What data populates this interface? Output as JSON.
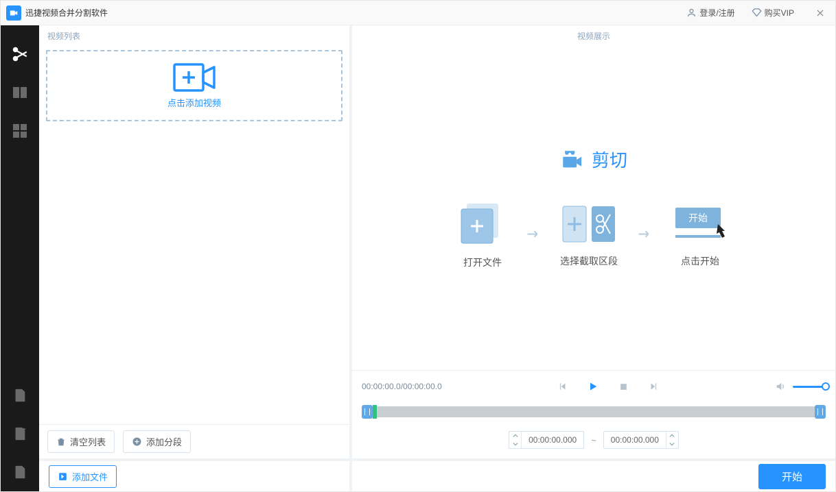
{
  "app": {
    "title": "迅捷视频合并分割软件"
  },
  "titleBar": {
    "login": "登录/注册",
    "buyVip": "购买VIP"
  },
  "left": {
    "header": "视频列表",
    "dropZone": "点击添加视频",
    "clearList": "清空列表",
    "addSegment": "添加分段",
    "addFile": "添加文件"
  },
  "right": {
    "header": "视频展示",
    "previewTitle": "剪切",
    "step1": "打开文件",
    "step2": "选择截取区段",
    "step3": "点击开始",
    "step3Button": "开始"
  },
  "player": {
    "time": "00:00:00.0/00:00:00.0",
    "startTime": "00:00:00.000",
    "endTime": "00:00:00.000",
    "separator": "~"
  },
  "bottom": {
    "start": "开始"
  }
}
